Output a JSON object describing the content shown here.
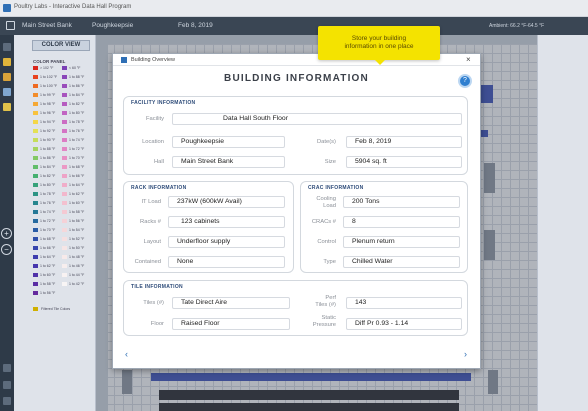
{
  "window": {
    "title": "Poultry Labs - Interactive Data Hall Program"
  },
  "toolbar": {
    "building": "Main Street Bank",
    "location": "Poughkeepsie",
    "date": "Feb 8, 2019",
    "ambient": "Ambient: 66.2 °F-64.5 °F"
  },
  "color_panel": {
    "view_button": "COLOR VIEW",
    "title": "COLOR PANEL",
    "legend_left": [
      "> 102 °F",
      "1 to 102 °F",
      "1 to 100 °F",
      "1 to 99 °F",
      "1 to 98 °F",
      "1 to 96 °F",
      "1 to 94 °F",
      "1 to 92 °F",
      "1 to 90 °F",
      "1 to 88 °F",
      "1 to 86 °F",
      "1 to 84 °F",
      "1 to 82 °F",
      "1 to 80 °F",
      "1 to 78 °F",
      "1 to 76 °F",
      "1 to 74 °F",
      "1 to 72 °F",
      "1 to 70 °F",
      "1 to 68 °F",
      "1 to 66 °F",
      "1 to 64 °F",
      "1 to 62 °F",
      "1 to 60 °F",
      "1 to 58 °F",
      "1 to 56 °F"
    ],
    "legend_right": [
      "< 60 °F",
      "1 to 88 °F",
      "1 to 86 °F",
      "1 to 84 °F",
      "1 to 82 °F",
      "1 to 80 °F",
      "1 to 78 °F",
      "1 to 76 °F",
      "1 to 74 °F",
      "1 to 72 °F",
      "1 to 70 °F",
      "1 to 68 °F",
      "1 to 66 °F",
      "1 to 64 °F",
      "1 to 62 °F",
      "1 to 60 °F",
      "1 to 58 °F",
      "1 to 56 °F",
      "1 to 54 °F",
      "1 to 52 °F",
      "1 to 50 °F",
      "1 to 48 °F",
      "1 to 46 °F",
      "1 to 44 °F",
      "1 to 42 °F"
    ],
    "footer": "Filtered Tile Colors",
    "swatch_colors": [
      "#d9261c",
      "#e8421e",
      "#ef6a21",
      "#f28c2a",
      "#f5a834",
      "#f8c23e",
      "#f4d749",
      "#e4e155",
      "#c6dd5a",
      "#a5d45e",
      "#84c964",
      "#62bd6a",
      "#45b070",
      "#36a27a",
      "#2d9484",
      "#27868e",
      "#257897",
      "#266a9f",
      "#2a5ca6",
      "#3050ab",
      "#3645ad",
      "#3d3cae",
      "#4636ad",
      "#5031a9",
      "#5a2da4",
      "#642a9e"
    ],
    "swatch_colors_right": [
      "#7a3fb5",
      "#8a46b8",
      "#9a4dbb",
      "#a854be",
      "#b65cc0",
      "#c164c2",
      "#cb6cc3",
      "#d474c4",
      "#dc7dc4",
      "#e286c4",
      "#e78fc4",
      "#eb99c5",
      "#eea3c7",
      "#f0adc9",
      "#f2b7cc",
      "#f3c0cf",
      "#f4c9d3",
      "#f5d1d7",
      "#f5d8db",
      "#f6dfe0",
      "#f6e5e5",
      "#f7eaea",
      "#f7eeee",
      "#f8f2f2",
      "#f8f5f5"
    ]
  },
  "tooltip": {
    "line1": "Store your building",
    "line2": "information in one place"
  },
  "dialog": {
    "title": "Building Overview",
    "heading": "BUILDING INFORMATION",
    "help": "?",
    "close": "×",
    "facility": {
      "section_title": "FACILITY INFORMATION",
      "facility_label": "Facility",
      "facility_value": "Data Hall South Floor",
      "location_label": "Location",
      "location_value": "Poughkeepsie",
      "date_label": "Date(s)",
      "date_value": "Feb 8, 2019",
      "hall_label": "Hall",
      "hall_value": "Main Street Bank",
      "size_label": "Size",
      "size_value": "5904 sq. ft"
    },
    "rack": {
      "section_title": "RACK INFORMATION",
      "it_load_label": "IT Load",
      "it_load_value": "237kW (600kW Avail)",
      "racks_label": "Racks #",
      "racks_value": "123 cabinets",
      "layout_label": "Layout",
      "layout_value": "Underfloor supply",
      "contained_label": "Contained",
      "contained_value": "None"
    },
    "crac": {
      "section_title": "CRAC INFORMATION",
      "cooling_label_1": "Cooling",
      "cooling_label_2": "Load",
      "cooling_value": "200 Tons",
      "cracs_label": "CRACs #",
      "cracs_value": "8",
      "control_label": "Control",
      "control_value": "Plenum return",
      "type_label": "Type",
      "type_value": "Chilled Water"
    },
    "tile": {
      "section_title": "TILE INFORMATION",
      "tiles_label": "Tiles (#)",
      "tiles_value": "Tate Direct Aire",
      "perf_label_1": "Perf",
      "perf_label_2": "Tiles (#)",
      "perf_value": "143",
      "floor_label": "Floor",
      "floor_value": "Raised Floor",
      "static_label_1": "Static",
      "static_label_2": "Pressure",
      "static_value": "Diff Pr 0.93 - 1.14"
    },
    "nav_prev": "‹",
    "nav_next": "›"
  },
  "colors": {
    "accent": "#2f6fb5",
    "section_title": "#2c4a78",
    "tooltip": "#f4e300"
  }
}
